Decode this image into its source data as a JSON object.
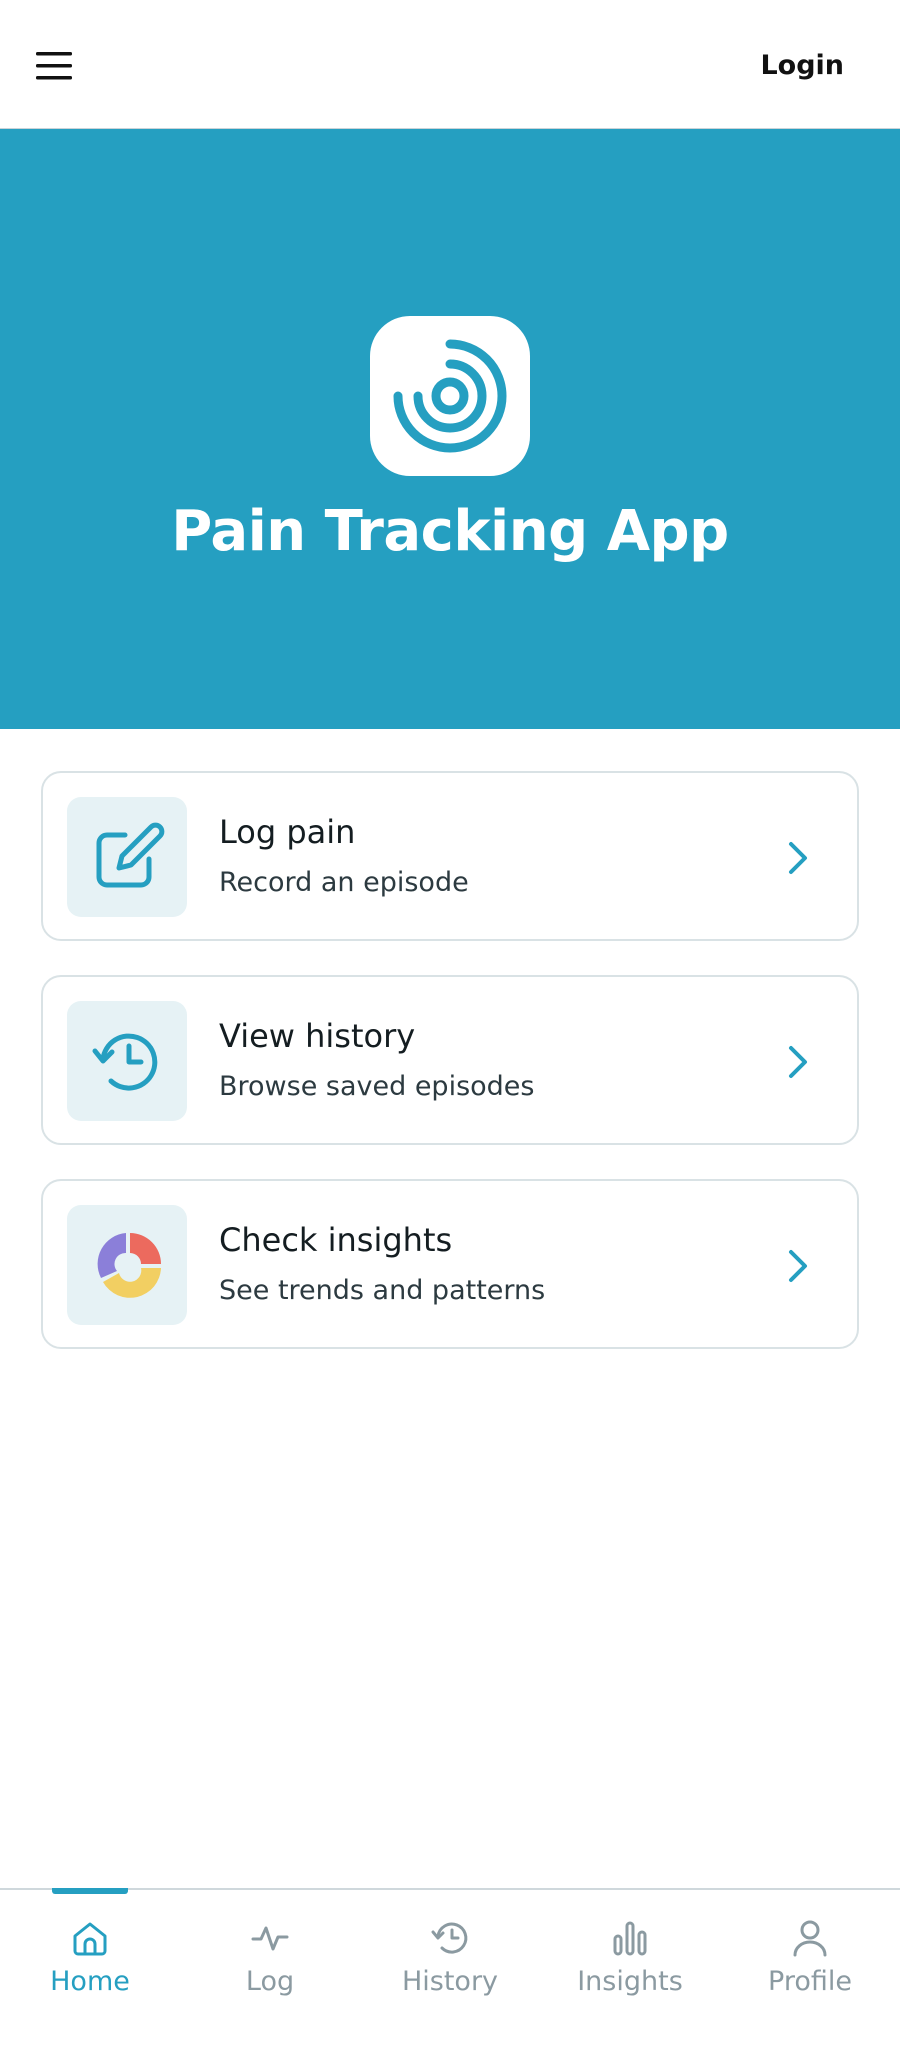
{
  "header": {
    "menu_icon": "hamburger-menu-icon",
    "login_label": "Login"
  },
  "hero": {
    "logo_icon": "concentric-target-icon",
    "title": "Pain Tracking App",
    "background_color": "#259fc1"
  },
  "cards": [
    {
      "icon": "pencil-square-icon",
      "title": "Log pain",
      "subtitle": "Record an episode"
    },
    {
      "icon": "history-clock-icon",
      "title": "View history",
      "subtitle": "Browse saved episodes"
    },
    {
      "icon": "donut-chart-icon",
      "title": "Check insights",
      "subtitle": "See trends and patterns"
    }
  ],
  "bottom_nav": {
    "active": "Home",
    "items": [
      {
        "label": "Home",
        "icon": "home-icon"
      },
      {
        "label": "Log",
        "icon": "activity-icon"
      },
      {
        "label": "History",
        "icon": "history-icon"
      },
      {
        "label": "Insights",
        "icon": "bar-chart-icon"
      },
      {
        "label": "Profile",
        "icon": "user-icon"
      }
    ]
  },
  "colors": {
    "accent": "#259fc1",
    "icon_bg": "#e6f2f5",
    "inactive_nav": "#8b9aa1",
    "chart_red": "#ec6a5e",
    "chart_yellow": "#f2cf62",
    "chart_purple": "#8b7fd9"
  }
}
